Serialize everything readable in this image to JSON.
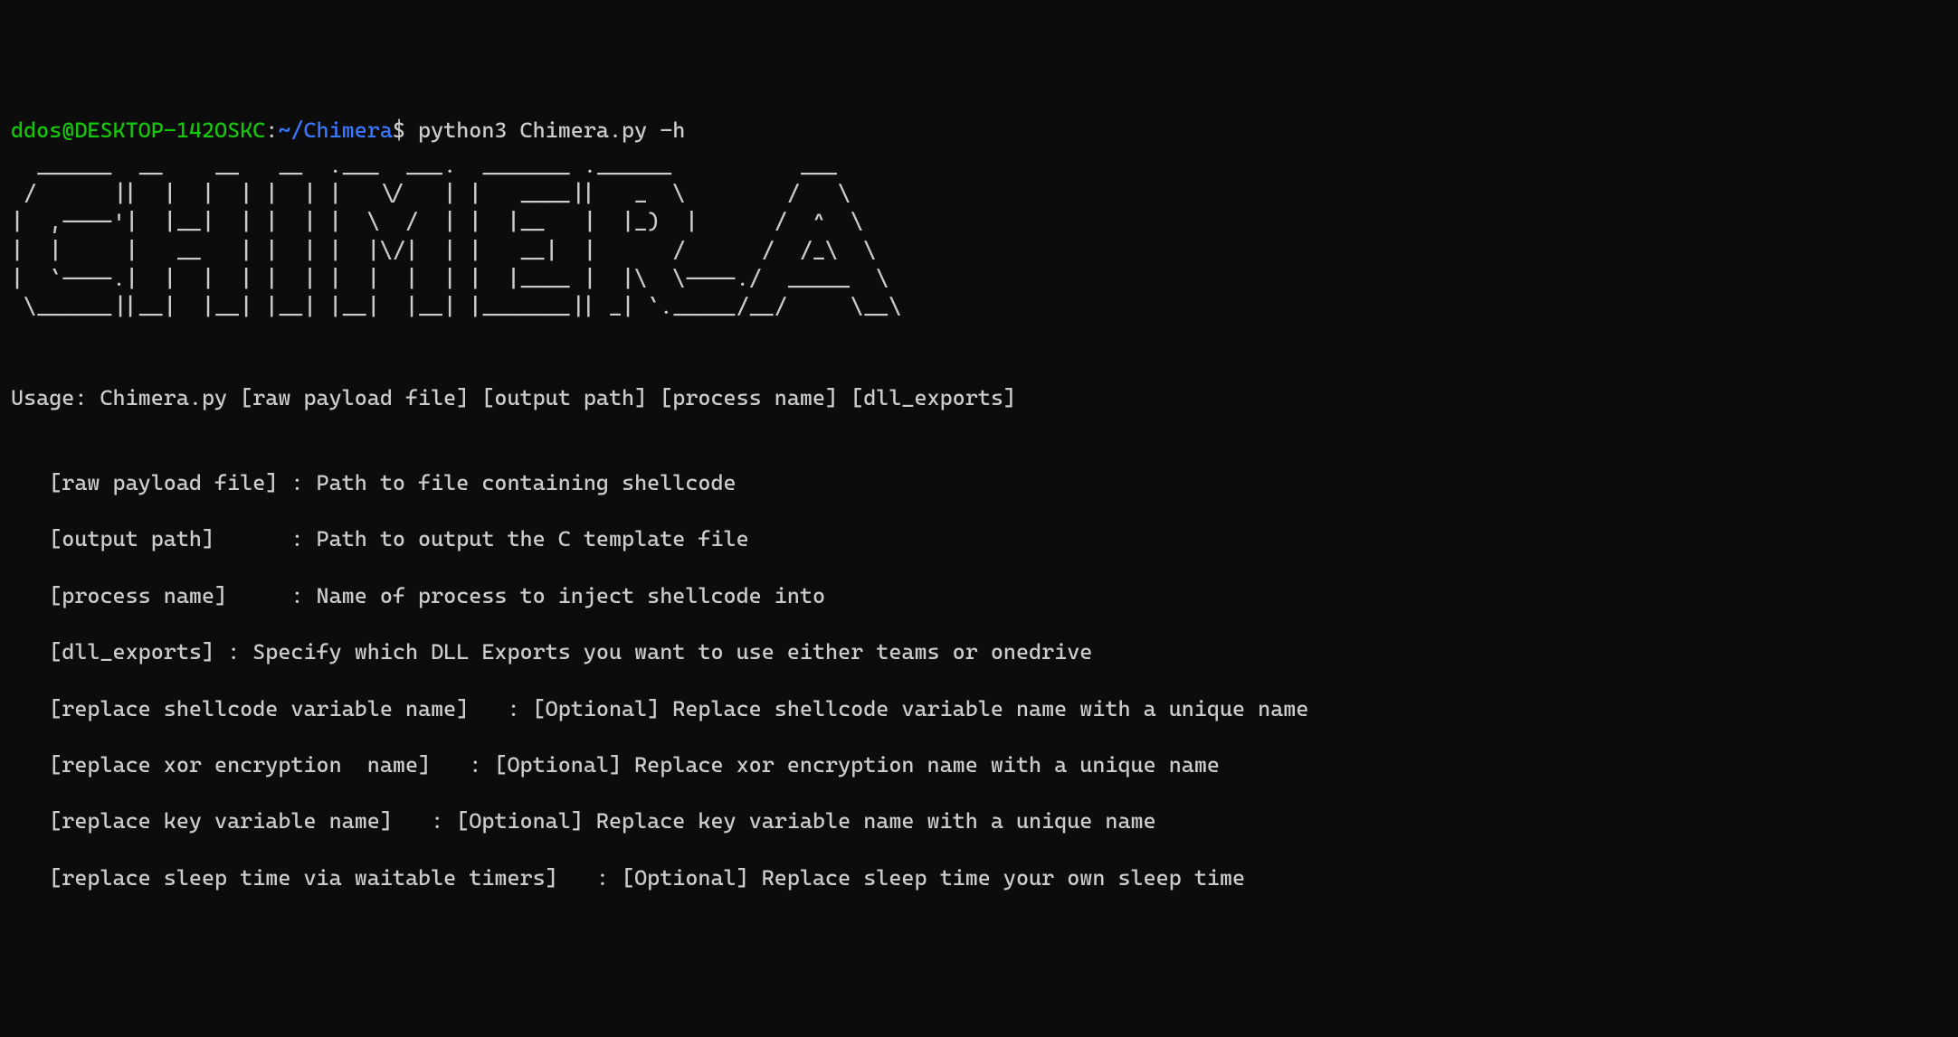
{
  "prompt": {
    "user": "ddos@DESKTOP-142OSKC",
    "colon": ":",
    "path": "~/Chimera",
    "dollar": "$ ",
    "command": "python3 Chimera.py -h"
  },
  "ascii_art": "  ______  __    __   __  .___  ___.  _______ .______          ___\n /      ||  |  |  | |  | |   \\/   | |   ____||   _  \\        /   \\\n|  ,----'|  |__|  | |  | |  \\  /  | |  |__   |  |_)  |      /  ^  \\\n|  |     |   __   | |  | |  |\\/|  | |   __|  |      /      /  /_\\  \\\n|  `----.|  |  |  | |  | |  |  |  | |  |____ |  |\\  \\----./  _____  \\\n \\______||__|  |__| |__| |__|  |__| |_______|| _| `._____/__/     \\__\\",
  "usage": "Usage: Chimera.py [raw payload file] [output path] [process name] [dll_exports]",
  "help_lines": [
    "   [raw payload file] : Path to file containing shellcode",
    "   [output path]      : Path to output the C template file",
    "   [process name]     : Name of process to inject shellcode into",
    "   [dll_exports] : Specify which DLL Exports you want to use either teams or onedrive",
    "   [replace shellcode variable name]   : [Optional] Replace shellcode variable name with a unique name",
    "   [replace xor encryption  name]   : [Optional] Replace xor encryption name with a unique name",
    "   [replace key variable name]   : [Optional] Replace key variable name with a unique name",
    "   [replace sleep time via waitable timers]   : [Optional] Replace sleep time your own sleep time"
  ]
}
